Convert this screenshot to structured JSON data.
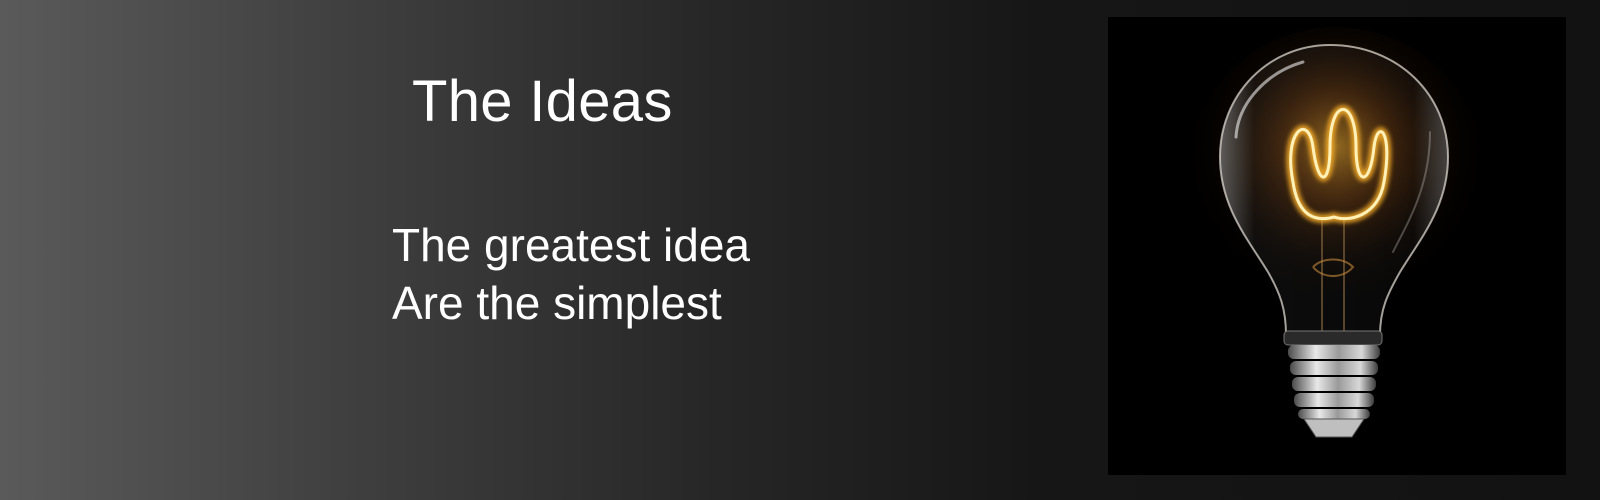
{
  "banner": {
    "title": "The Ideas",
    "tagline_line1": "The greatest idea",
    "tagline_line2": "Are the simplest"
  },
  "image": {
    "subject": "light-bulb",
    "background_color": "#000000",
    "glow_color": "#ffb32a"
  },
  "colors": {
    "text": "#ffffff",
    "gradient_left": "#5a5a5a",
    "gradient_right": "#121212"
  }
}
